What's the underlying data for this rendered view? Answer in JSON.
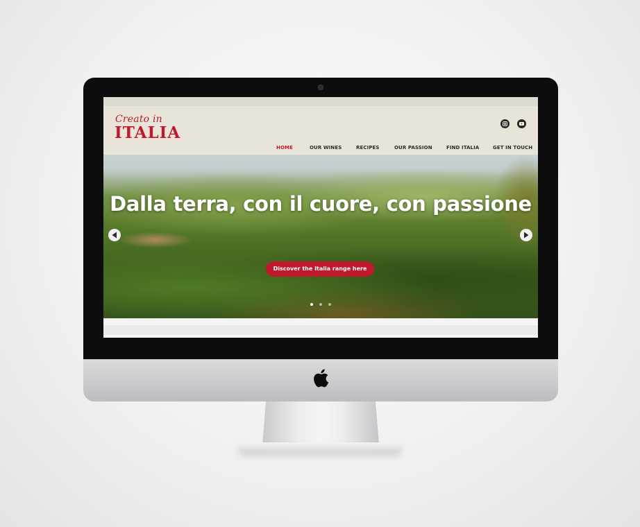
{
  "logo": {
    "script": "Creato in",
    "main": "ITALIA"
  },
  "social": [
    "instagram-icon",
    "youtube-icon"
  ],
  "nav": {
    "items": [
      {
        "label": "HOME",
        "active": true
      },
      {
        "label": "OUR WINES",
        "active": false
      },
      {
        "label": "RECIPES",
        "active": false
      },
      {
        "label": "OUR PASSION",
        "active": false
      },
      {
        "label": "FIND ITALIA",
        "active": false
      },
      {
        "label": "GET IN TOUCH",
        "active": false
      }
    ]
  },
  "hero": {
    "headline": "Dalla terra, con il cuore, con passione",
    "cta": "Discover the Italia range here",
    "slide_count": 3,
    "active_slide": 1
  },
  "colors": {
    "brand_red": "#c0192c",
    "header_bg": "#e8e5d8",
    "nav_text": "#2d2a27"
  }
}
